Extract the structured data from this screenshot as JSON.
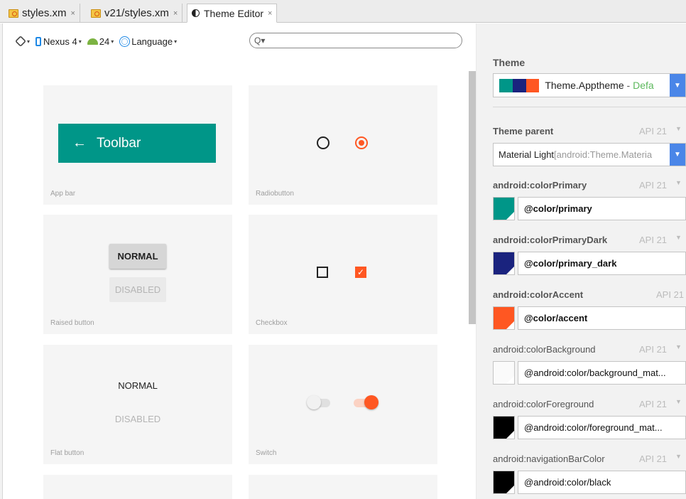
{
  "tabs": [
    {
      "label": "styles.xm",
      "close": "×"
    },
    {
      "label": "v21/styles.xm",
      "close": "×"
    },
    {
      "label": "Theme Editor",
      "close": "×"
    }
  ],
  "toolbar": {
    "device": "Nexus 4",
    "api": "24",
    "language": "Language",
    "search_placeholder": ""
  },
  "cards": {
    "appbar": {
      "title": "Toolbar",
      "label": "App bar"
    },
    "radiobutton": {
      "label": "Radiobutton"
    },
    "raised": {
      "normal": "NORMAL",
      "disabled": "DISABLED",
      "label": "Raised button"
    },
    "checkbox": {
      "label": "Checkbox"
    },
    "flat": {
      "normal": "NORMAL",
      "disabled": "DISABLED",
      "label": "Flat button"
    },
    "switch": {
      "label": "Switch"
    }
  },
  "panel": {
    "theme_title": "Theme",
    "theme_name": "Theme.Apptheme",
    "theme_dash": " - ",
    "theme_default": "Defa",
    "theme_swatches": [
      "#009688",
      "#1a237e",
      "#ff5722"
    ],
    "parent_title": "Theme parent",
    "parent_api": "API 21",
    "parent_value": "Material Light",
    "parent_ref": " [android:Theme.Materia",
    "attributes": [
      {
        "name": "android:colorPrimary",
        "api": "API 21",
        "value": "@color/primary",
        "color": "#009688",
        "bold": true
      },
      {
        "name": "android:colorPrimaryDark",
        "api": "API 21",
        "value": "@color/primary_dark",
        "color": "#1a237e",
        "bold": true
      },
      {
        "name": "android:colorAccent",
        "api": "API 21",
        "value": "@color/accent",
        "color": "#ff5722",
        "bold": true
      },
      {
        "name": "android:colorBackground",
        "api": "API 21",
        "value": "@android:color/background_mat...",
        "color": "#fafafa",
        "bold": false
      },
      {
        "name": "android:colorForeground",
        "api": "API 21",
        "value": "@android:color/foreground_mat...",
        "color": "#000000",
        "bold": false
      },
      {
        "name": "android:navigationBarColor",
        "api": "API 21",
        "value": "@android:color/black",
        "color": "#000000",
        "bold": false
      }
    ]
  }
}
